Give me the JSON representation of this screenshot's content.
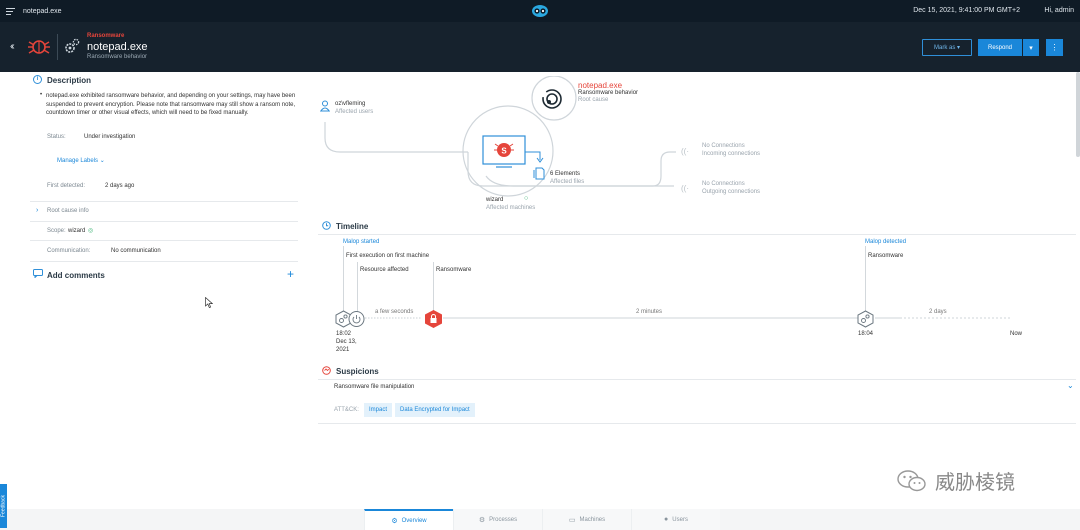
{
  "topbar": {
    "app_title": "notepad.exe",
    "datetime": "Dec 15, 2021, 9:41:00 PM GMT+2",
    "user": "Hi, admin"
  },
  "header": {
    "tag": "Ransomware",
    "title": "notepad.exe",
    "subtitle": "Ransomware behavior",
    "mark_as_label": "Mark as",
    "respond_label": "Respond"
  },
  "description": {
    "title": "Description",
    "text": "notepad.exe exhibited ransomware behavior, and depending on your settings, may have been suspended to prevent encryption. Please note that ransomware may still show a ransom note, countdown timer or other visual effects, which will need to be fixed manually.",
    "status_label": "Status:",
    "status_value": "Under investigation",
    "manage_labels": "Manage Labels",
    "first_detected_label": "First detected:",
    "first_detected_value": "2 days ago",
    "root_cause_info": "Root cause info",
    "scope_label": "Scope:",
    "scope_value": "wizard",
    "communication_label": "Communication:",
    "communication_value": "No communication"
  },
  "comments": {
    "title": "Add comments"
  },
  "graph": {
    "root_name": "notepad.exe",
    "root_behavior": "Ransomware behavior",
    "root_role": "Root cause",
    "user_name": "oz\\vfleming",
    "user_role": "Affected users",
    "files_count": "6 Elements",
    "files_role": "Affected files",
    "incoming_title": "No Connections",
    "incoming_role": "Incoming connections",
    "outgoing_title": "No Connections",
    "outgoing_role": "Outgoing connections",
    "machine_name": "wizard",
    "machine_role": "Affected machines"
  },
  "timeline": {
    "title": "Timeline",
    "malop_started": "Malop started",
    "malop_detected": "Malop detected",
    "first_execution": "First execution on first machine",
    "resource_affected": "Resource affected",
    "ransomware_left": "Ransomware",
    "ransomware_right": "Ransomware",
    "gap1": "a few seconds",
    "gap2": "2 minutes",
    "gap3": "2 days",
    "start_time": "18:02",
    "start_date1": "Dec 13,",
    "start_date2": "2021",
    "detected_time": "18:04",
    "now": "Now"
  },
  "suspicions": {
    "title": "Suspicions",
    "item": "Ransomware file manipulation",
    "attack_label": "ATT&CK:",
    "tags": [
      "Impact",
      "Data Encrypted for Impact"
    ]
  },
  "bottom_nav": {
    "tabs": [
      {
        "label": "Overview",
        "icon": "gear-icon"
      },
      {
        "label": "Processes",
        "icon": "processes-icon"
      },
      {
        "label": "Machines",
        "icon": "monitor-icon"
      },
      {
        "label": "Users",
        "icon": "user-icon"
      }
    ]
  },
  "feedback": "Feedback",
  "watermark": "威胁棱镜",
  "colors": {
    "accent": "#1a87d9",
    "danger": "#e5453b",
    "topbar": "#0f1b26",
    "header": "#16222d"
  }
}
